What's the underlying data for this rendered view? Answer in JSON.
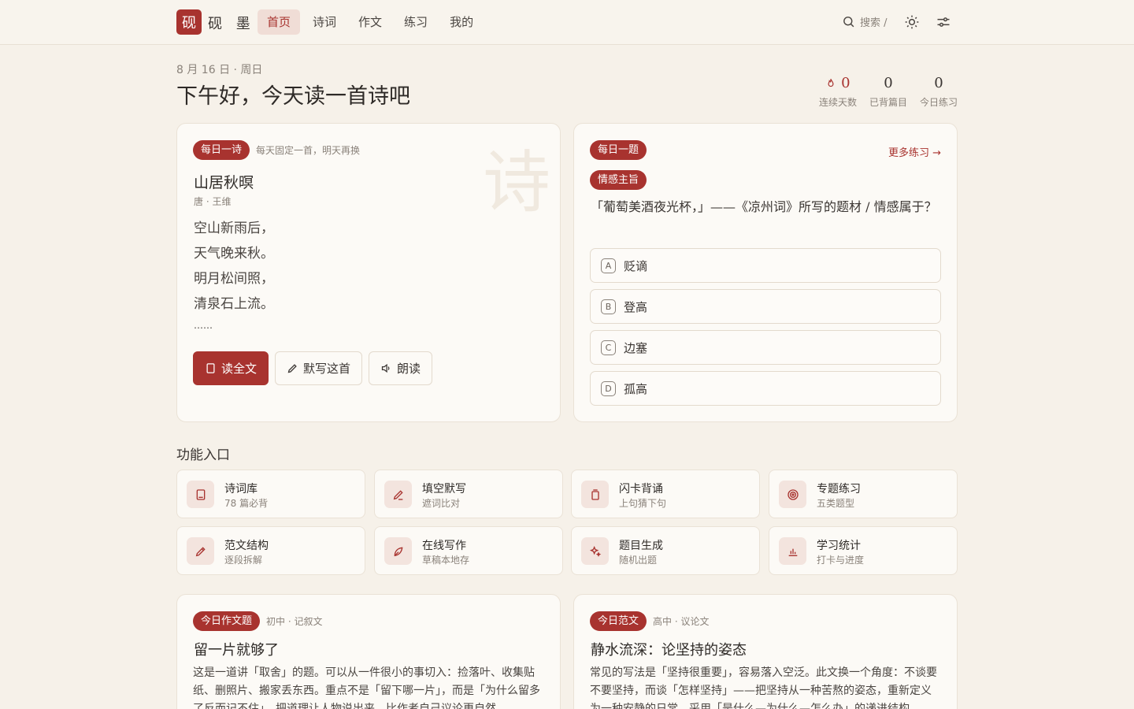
{
  "app": {
    "logo_char": "砚",
    "name": "砚 墨"
  },
  "nav": [
    {
      "label": "首页",
      "active": true
    },
    {
      "label": "诗词",
      "active": false
    },
    {
      "label": "作文",
      "active": false
    },
    {
      "label": "练习",
      "active": false
    },
    {
      "label": "我的",
      "active": false
    }
  ],
  "search": {
    "label": "搜索 /",
    "icon": "search-icon"
  },
  "top_icons": [
    "sun-icon",
    "sliders-icon"
  ],
  "header": {
    "date": "8 月 16 日 · 周日",
    "greeting": "下午好，今天读一首诗吧"
  },
  "stats": [
    {
      "value": "0",
      "label": "连续天数",
      "icon": "flame-icon"
    },
    {
      "value": "0",
      "label": "已背篇目"
    },
    {
      "value": "0",
      "label": "今日练习"
    }
  ],
  "poem": {
    "badge": "每日一诗",
    "note": "每天固定一首，明天再换",
    "watermark": "诗",
    "title": "山居秋暝",
    "author": "唐 · 王维",
    "lines": [
      "空山新雨后，",
      "天气晚来秋。",
      "明月松间照，",
      "清泉石上流。",
      "……"
    ],
    "buttons": {
      "read_full": "读全文",
      "dictate": "默写这首",
      "recite": "朗读"
    }
  },
  "quiz": {
    "badge": "每日一题",
    "tag": "情感主旨",
    "more": "更多练习 →",
    "question": "「葡萄美酒夜光杯，」——《凉州词》所写的题材 / 情感属于？",
    "options": [
      {
        "letter": "A",
        "text": "贬谪"
      },
      {
        "letter": "B",
        "text": "登高"
      },
      {
        "letter": "C",
        "text": "边塞"
      },
      {
        "letter": "D",
        "text": "孤高"
      }
    ]
  },
  "features": {
    "title": "功能入口",
    "items": [
      {
        "title": "诗词库",
        "sub": "78 篇必背",
        "icon": "book-icon"
      },
      {
        "title": "填空默写",
        "sub": "遮词比对",
        "icon": "pen-icon"
      },
      {
        "title": "闪卡背诵",
        "sub": "上句猜下句",
        "icon": "cards-icon"
      },
      {
        "title": "专题练习",
        "sub": "五类题型",
        "icon": "target-icon"
      },
      {
        "title": "范文结构",
        "sub": "逐段拆解",
        "icon": "pencil-icon"
      },
      {
        "title": "在线写作",
        "sub": "草稿本地存",
        "icon": "feather-icon"
      },
      {
        "title": "题目生成",
        "sub": "随机出题",
        "icon": "sparkle-icon"
      },
      {
        "title": "学习统计",
        "sub": "打卡与进度",
        "icon": "bar-chart-icon"
      }
    ]
  },
  "essay_topic": {
    "badge": "今日作文题",
    "meta": "初中 · 记叙文",
    "title": "留一片就够了",
    "text": "这是一道讲「取舍」的题。可以从一件很小的事切入：捡落叶、收集贴纸、删照片、搬家丢东西。重点不是「留下哪一片」，而是「为什么留多了反而记不住」。把道理让人物说出来，比作者自己议论更自然。"
  },
  "model_essay": {
    "badge": "今日范文",
    "meta": "高中 · 议论文",
    "title": "静水流深：论坚持的姿态",
    "text": "常见的写法是「坚持很重要」，容易落入空泛。此文换一个角度：不谈要不要坚持，而谈「怎样坚持」——把坚持从一种苦熬的姿态，重新定义为一种安静的日常。采用「是什么—为什么—怎么办」的递进结构。"
  },
  "colors": {
    "accent": "#a8332f",
    "background": "#f6f1e9",
    "card": "#fcfaf6"
  }
}
